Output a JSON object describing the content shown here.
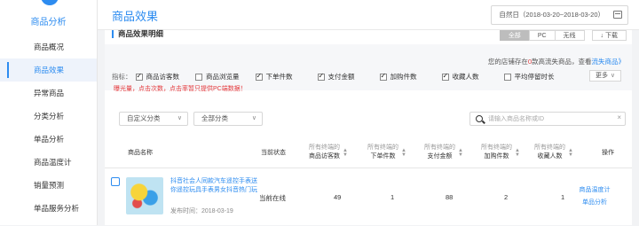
{
  "sidebar": {
    "title": "商品分析",
    "items": [
      {
        "label": "商品概况",
        "active": false
      },
      {
        "label": "商品效果",
        "active": true
      },
      {
        "label": "异常商品",
        "active": false
      },
      {
        "label": "分类分析",
        "active": false
      },
      {
        "label": "单品分析",
        "active": false
      },
      {
        "label": "商品温度计",
        "active": false
      },
      {
        "label": "销量预测",
        "active": false
      },
      {
        "label": "单品服务分析",
        "active": false
      }
    ]
  },
  "header": {
    "title": "商品效果",
    "date_range": "自然日（2018-03-20~2018-03-20）"
  },
  "section": {
    "title": "商品效果明细",
    "view_buttons": [
      "全部",
      "PC",
      "无线"
    ],
    "download": "↓ 下载"
  },
  "metrics": {
    "lost_prefix": "您的店铺存在",
    "lost_count": "0",
    "lost_mid": "款高流失商品，查看",
    "lost_link": "流失商品",
    "lost_suffix": "》",
    "label": "指标：",
    "items": [
      {
        "label": "商品访客数",
        "checked": true
      },
      {
        "label": "商品浏览量",
        "checked": false
      },
      {
        "label": "下单件数",
        "checked": true
      },
      {
        "label": "支付金额",
        "checked": true
      },
      {
        "label": "加购件数",
        "checked": true
      },
      {
        "label": "收藏人数",
        "checked": true
      },
      {
        "label": "平均停留时长",
        "checked": false
      }
    ],
    "more": "更多"
  },
  "warning": "曝光量，点击次数，点击率暂只提供PC端数据！",
  "filters": {
    "custom": "自定义分类",
    "all": "全部分类",
    "search_placeholder": "请输入商品名称或ID"
  },
  "table": {
    "headers": [
      {
        "sub": "",
        "main": "商品名称"
      },
      {
        "sub": "",
        "main": "当前状态"
      },
      {
        "sub": "所有终端的",
        "main": "商品访客数"
      },
      {
        "sub": "所有终端的",
        "main": "下单件数"
      },
      {
        "sub": "所有终端的",
        "main": "支付金额"
      },
      {
        "sub": "所有终端的",
        "main": "加购件数"
      },
      {
        "sub": "所有终端的",
        "main": "收藏人数"
      },
      {
        "sub": "",
        "main": "操作"
      }
    ],
    "rows": [
      {
        "name": "抖音社会人同款汽车遥控手表送你遥控玩具手表男女抖音热门玩",
        "publish": "发布时间：2018-03-19",
        "status": "当前在线",
        "visitors": "49",
        "orders": "1",
        "payment": "88",
        "cart": "2",
        "favorites": "1",
        "op1": "商品温度计",
        "op2": "单品分析"
      }
    ]
  }
}
